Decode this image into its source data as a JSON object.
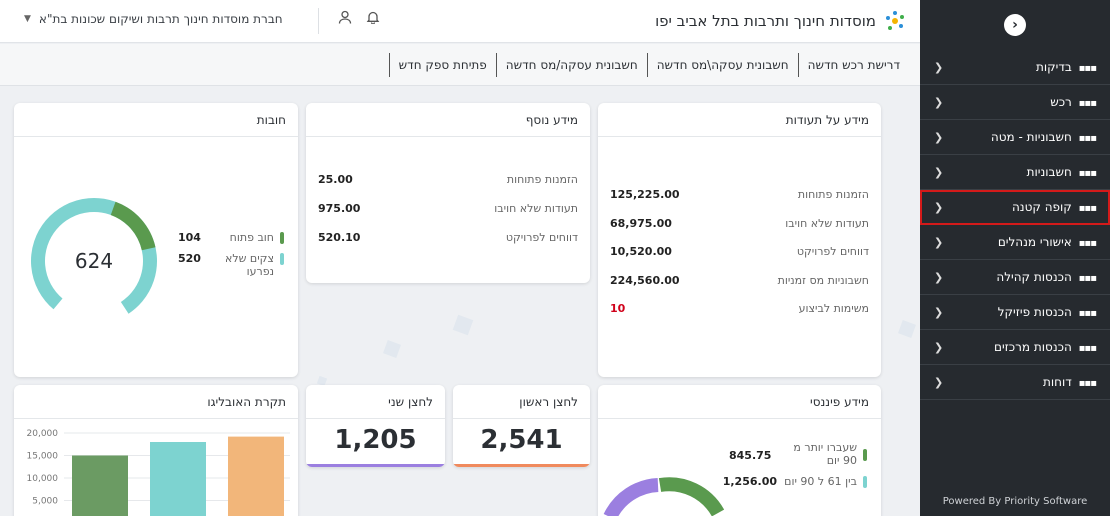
{
  "sidebar": {
    "items": [
      {
        "label": "בדיקות"
      },
      {
        "label": "רכש"
      },
      {
        "label": "חשבוניות - מטה"
      },
      {
        "label": "חשבוניות"
      },
      {
        "label": "קופה קטנה",
        "active": true
      },
      {
        "label": "אישורי מנהלים"
      },
      {
        "label": "הכנסות קהילה"
      },
      {
        "label": "הכנסות פיזיקל"
      },
      {
        "label": "הכנסות מרכזים"
      },
      {
        "label": "דוחות"
      }
    ],
    "footer": "Powered By Priority Software"
  },
  "header": {
    "title": "מוסדות חינוך ותרבות בתל אביב יפו",
    "company": "חברת מוסדות חינוך תרבות ושיקום שכונות בת\"א"
  },
  "actions": [
    {
      "label": "דרישת רכש חדשה"
    },
    {
      "label": "חשבונית עסקה\\מס חדשה"
    },
    {
      "label": "חשבונית עסקה/מס חדשה"
    },
    {
      "label": "פתיחת ספק חדש"
    }
  ],
  "cards": {
    "certificates": {
      "title": "מידע על תעודות",
      "rows": [
        {
          "label": "הזמנות פתוחות",
          "value": "125,225.00"
        },
        {
          "label": "תעודות שלא חויבו",
          "value": "68,975.00"
        },
        {
          "label": "דווחים לפרויקט",
          "value": "10,520.00"
        },
        {
          "label": "חשבוניות מס זמניות",
          "value": "224,560.00"
        },
        {
          "label": "משימות לביצוע",
          "value": "10"
        }
      ]
    },
    "extra": {
      "title": "מידע נוסף",
      "rows": [
        {
          "label": "הזמנות פתוחות",
          "value": "25.00"
        },
        {
          "label": "תעודות שלא חויבו",
          "value": "975.00"
        },
        {
          "label": "דווחים לפרויקט",
          "value": "520.10"
        }
      ]
    },
    "debts": {
      "title": "חובות",
      "total": "624",
      "legend": [
        {
          "label": "חוב פתוח",
          "value": "104",
          "color": "#5a9a4e"
        },
        {
          "label": "צקים שלא נפרעו",
          "value": "520",
          "color": "#7dd3d0"
        }
      ]
    },
    "financial": {
      "title": "מידע פיננסי",
      "legend": [
        {
          "label": "שעברו יותר מ 90 יום",
          "value": "845.75",
          "color": "#5a9a4e"
        },
        {
          "label": "בין 61 ל 90 יום",
          "value": "1,256.00",
          "color": "#7dd3d0"
        }
      ]
    },
    "kpi1": {
      "title": "לחצן ראשון",
      "value": "2,541",
      "color": "#f08a5d"
    },
    "kpi2": {
      "title": "לחצן שני",
      "value": "1,205",
      "color": "#9b7fe0"
    },
    "budget": {
      "title": "תקרת האובליגו"
    }
  },
  "chart_data": {
    "type": "bar",
    "categories": [
      "",
      "",
      ""
    ],
    "series": [
      {
        "values": [
          15000,
          18000,
          19200
        ]
      }
    ],
    "colors": [
      "#6b9b63",
      "#7dd3d0",
      "#f2b67a"
    ],
    "yticks": [
      "20,000",
      "15,000",
      "10,000",
      "5,000"
    ],
    "ylim": [
      0,
      20000
    ],
    "grid": true
  }
}
